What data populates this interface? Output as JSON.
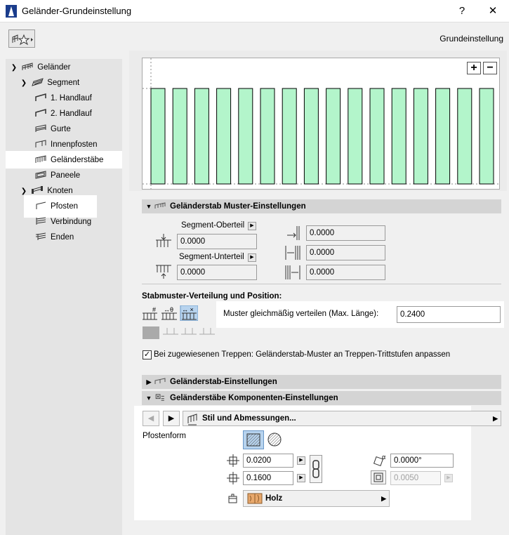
{
  "window": {
    "title": "Geländer-Grundeinstellung",
    "help_label": "?",
    "close_label": "✕"
  },
  "header": {
    "right_label": "Grundeinstellung"
  },
  "tree": {
    "items": [
      {
        "label": "Geländer"
      },
      {
        "label": "Segment"
      },
      {
        "label": "1. Handlauf"
      },
      {
        "label": "2. Handlauf"
      },
      {
        "label": "Gurte"
      },
      {
        "label": "Innenpfosten"
      },
      {
        "label": "Geländerstäbe"
      },
      {
        "label": "Paneele"
      },
      {
        "label": "Knoten"
      },
      {
        "label": "Pfosten"
      },
      {
        "label": "Verbindung"
      },
      {
        "label": "Enden"
      }
    ]
  },
  "preview": {
    "zoom_in": "+",
    "zoom_out": "−",
    "colors": {
      "fill": "#b3f5cb",
      "stroke": "#000000"
    }
  },
  "muster_section": {
    "title": "Geländerstab Muster-Einstellungen",
    "segment_top_label": "Segment-Oberteil",
    "segment_top_value": "0.0000",
    "segment_bottom_label": "Segment-Unterteil",
    "segment_bottom_value": "0.0000",
    "right_values": [
      "0.0000",
      "0.0000",
      "0.0000"
    ]
  },
  "distribution": {
    "heading": "Stabmuster-Verteilung und Position:",
    "muster_label": "Muster gleichmäßig verteilen (Max. Länge):",
    "muster_value": "0.2400",
    "checkbox_label": "Bei zugewiesenen Treppen: Geländerstab-Muster an Treppen-Trittstufen anpassen",
    "checkbox_checked": true
  },
  "stab_section": {
    "title": "Geländerstab-Einstellungen"
  },
  "komponenten_section": {
    "title": "Geländerstäbe Komponenten-Einstellungen",
    "nav_dropdown": "Stil und Abmessungen...",
    "pfostenform_label": "Pfostenform",
    "width_value": "0.0200",
    "height_value": "0.1600",
    "angle_value": "0.0000°",
    "offset_value": "0.0050",
    "material_label": "Holz"
  }
}
